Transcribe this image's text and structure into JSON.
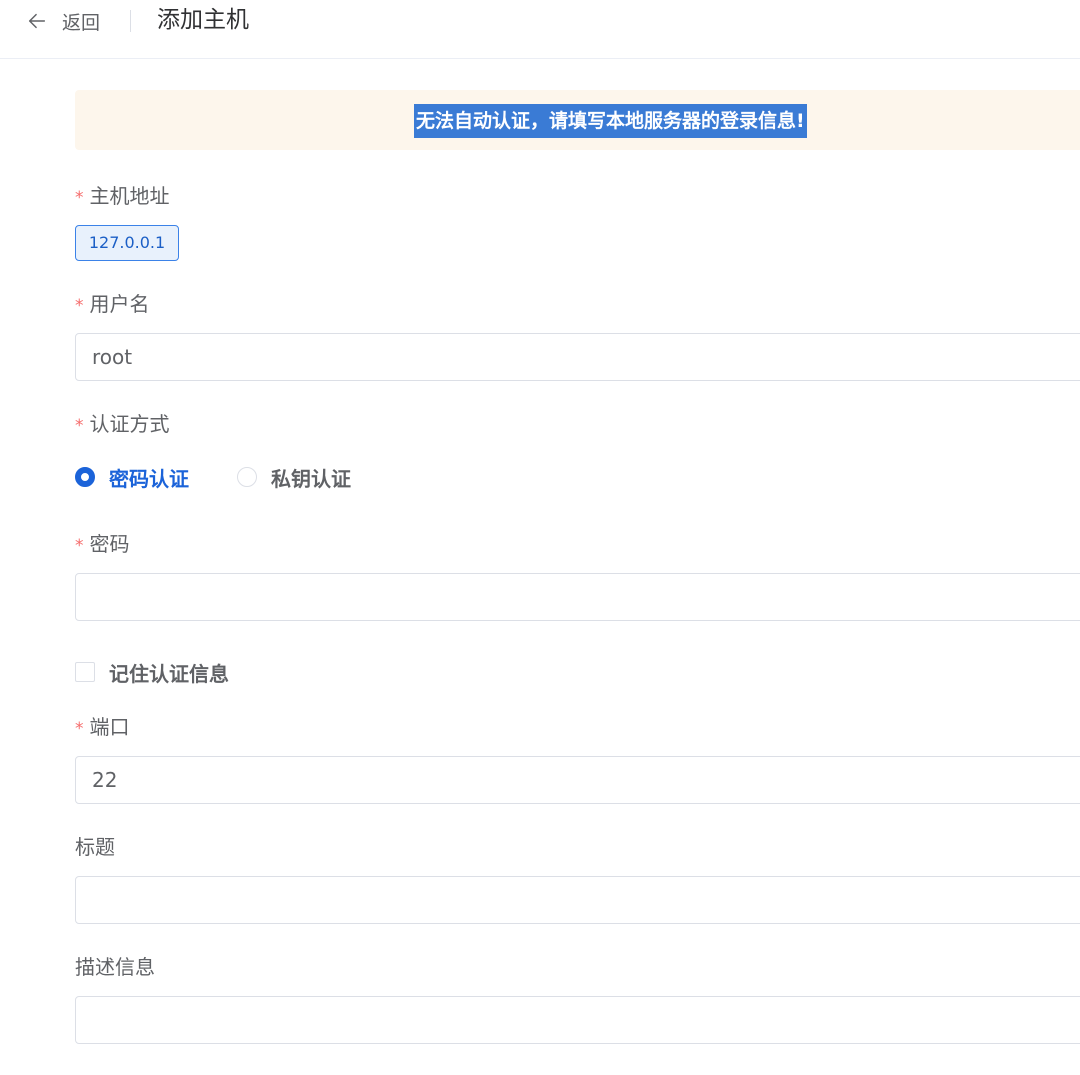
{
  "header": {
    "back_label": "返回",
    "title": "添加主机"
  },
  "alert": {
    "text": "无法自动认证，请填写本地服务器的登录信息!"
  },
  "form": {
    "host": {
      "label": "主机地址",
      "required": true,
      "tag": "127.0.0.1"
    },
    "username": {
      "label": "用户名",
      "required": true,
      "value": "root"
    },
    "auth_method": {
      "label": "认证方式",
      "required": true,
      "options": [
        {
          "label": "密码认证",
          "checked": true
        },
        {
          "label": "私钥认证",
          "checked": false
        }
      ]
    },
    "password": {
      "label": "密码",
      "required": true,
      "value": ""
    },
    "remember": {
      "label": "记住认证信息",
      "checked": false
    },
    "port": {
      "label": "端口",
      "required": true,
      "value": "22"
    },
    "title_field": {
      "label": "标题",
      "value": ""
    },
    "description": {
      "label": "描述信息",
      "value": ""
    }
  },
  "colors": {
    "primary": "#1b63d9",
    "required": "#f56c6c",
    "alert_bg": "#fdf6ec",
    "selection_bg": "#3a7bd5"
  },
  "icons": {
    "back": "arrow-left-icon"
  }
}
